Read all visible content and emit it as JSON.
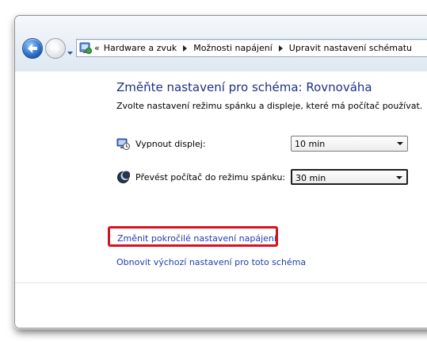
{
  "navigation": {
    "back_icon": "back-arrow-icon",
    "forward_icon": "forward-arrow-icon",
    "history_icon": "chevron-down-icon"
  },
  "address_bar": {
    "icon": "control-panel-icon",
    "overflow": "«",
    "breadcrumbs": [
      "Hardware a zvuk",
      "Možnosti napájení",
      "Upravit nastavení schématu"
    ]
  },
  "main": {
    "title": "Změňte nastavení pro schéma: Rovnováha",
    "subtitle": "Zvolte nastavení režimu spánku a displeje, které má počítač používat.",
    "settings": [
      {
        "icon": "monitor-clock-icon",
        "label": "Vypnout displej:",
        "value": "10 min"
      },
      {
        "icon": "moon-icon",
        "label": "Převést počítač do režimu spánku:",
        "value": "30 min"
      }
    ],
    "links": {
      "advanced": "Změnit pokročilé nastavení napájení",
      "restore": "Obnovit výchozí nastavení pro toto schéma"
    }
  },
  "colors": {
    "title": "#1e3287",
    "link": "#1e3ea8",
    "highlight_box": "#d3141f"
  }
}
